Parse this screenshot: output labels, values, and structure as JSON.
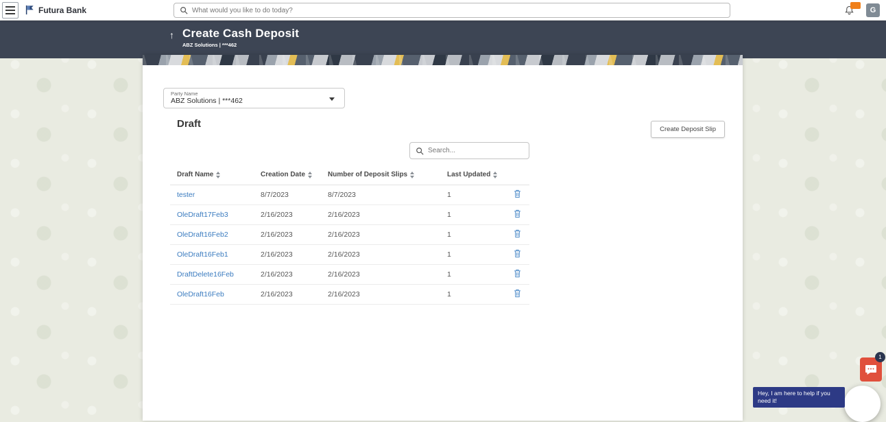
{
  "topbar": {
    "brand": "Futura Bank",
    "search_placeholder": "What would you like to do today?",
    "notification_badge": "",
    "avatar_initial": "G"
  },
  "page_header": {
    "back_arrow": "↑",
    "title": "Create Cash Deposit",
    "subtitle": "ABZ Solutions | ***462"
  },
  "party_select": {
    "label": "Party Name",
    "value": "ABZ Solutions | ***462"
  },
  "draft_section": {
    "title": "Draft",
    "create_button_label": "Create Deposit Slip",
    "search_placeholder": "Search...",
    "table": {
      "columns": [
        "Draft Name",
        "Creation Date",
        "Number of Deposit Slips",
        "Last Updated"
      ],
      "rows": [
        {
          "draft_name": "tester",
          "creation_date": "8/7/2023",
          "number_of_deposit_slips": "8/7/2023",
          "last_updated": "1"
        },
        {
          "draft_name": "OleDraft17Feb3",
          "creation_date": "2/16/2023",
          "number_of_deposit_slips": "2/16/2023",
          "last_updated": "1"
        },
        {
          "draft_name": "OleDraft16Feb2",
          "creation_date": "2/16/2023",
          "number_of_deposit_slips": "2/16/2023",
          "last_updated": "1"
        },
        {
          "draft_name": "OleDraft16Feb1",
          "creation_date": "2/16/2023",
          "number_of_deposit_slips": "2/16/2023",
          "last_updated": "1"
        },
        {
          "draft_name": "DraftDelete16Feb",
          "creation_date": "2/16/2023",
          "number_of_deposit_slips": "2/16/2023",
          "last_updated": "1"
        },
        {
          "draft_name": "OleDraft16Feb",
          "creation_date": "2/16/2023",
          "number_of_deposit_slips": "2/16/2023",
          "last_updated": "1"
        }
      ]
    }
  },
  "chat_widget": {
    "badge": "1",
    "tooltip_text": "Hey, I am here to help if you need it!"
  },
  "colors": {
    "header_bg": "#3d4554",
    "accent_red": "#e0503c",
    "link_blue": "#3a7bbf",
    "badge_orange": "#f0801a",
    "tooltip_navy": "#2d3a85"
  }
}
